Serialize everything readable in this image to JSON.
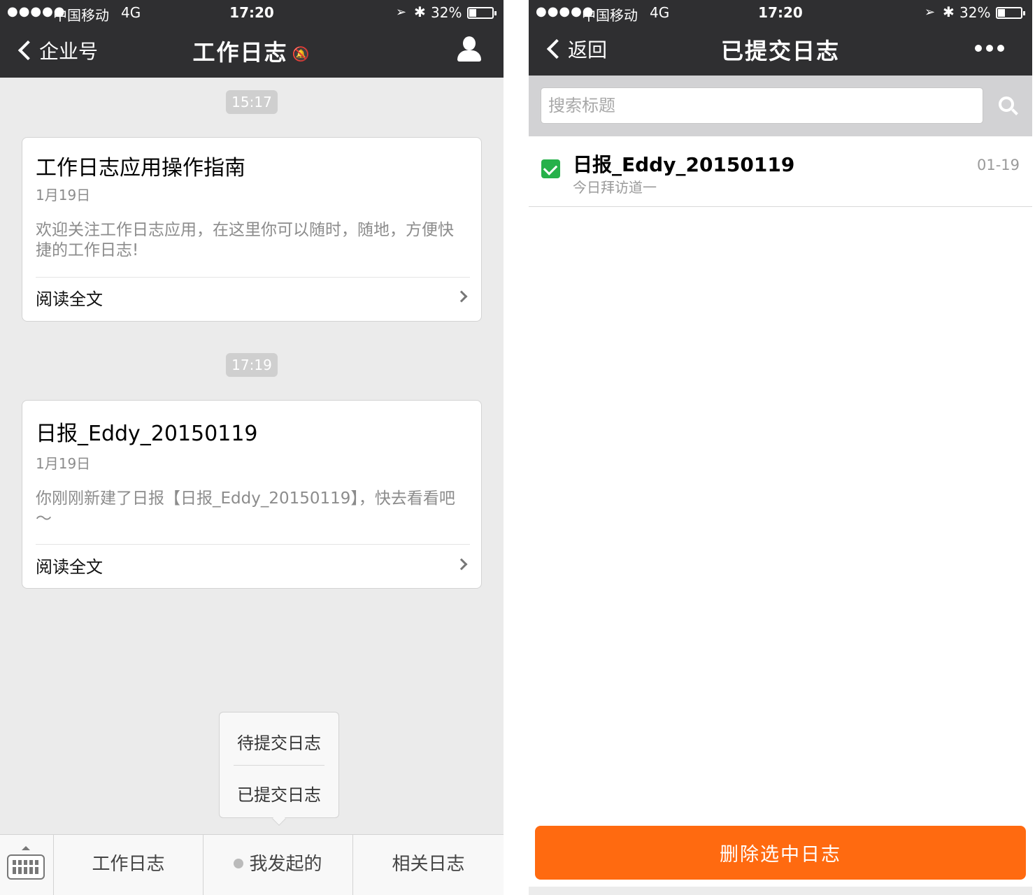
{
  "left": {
    "status": {
      "signal": "●●●●●",
      "carrier": "中国移动",
      "network": "4G",
      "time": "17:20",
      "battery_pct": "32%",
      "battery_level": 0.32
    },
    "nav": {
      "back_label": "企业号",
      "title": "工作日志"
    },
    "messages": [
      {
        "time": "15:17",
        "title": "工作日志应用操作指南",
        "date": "1月19日",
        "body": "欢迎关注工作日志应用，在这里你可以随时，随地，方便快捷的工作日志!",
        "link": "阅读全文"
      },
      {
        "time": "17:19",
        "title": "日报_Eddy_20150119",
        "date": "1月19日",
        "body": "你刚刚新建了日报【日报_Eddy_20150119】，快去看看吧～",
        "link": "阅读全文"
      }
    ],
    "popup": {
      "items": [
        "待提交日志",
        "已提交日志"
      ]
    },
    "menu": {
      "items": [
        "工作日志",
        "我发起的",
        "相关日志"
      ]
    }
  },
  "right": {
    "status": {
      "signal": "●●●●●",
      "carrier": "中国移动",
      "network": "4G",
      "time": "17:20",
      "battery_pct": "32%",
      "battery_level": 0.32
    },
    "nav": {
      "back_label": "返回",
      "title": "已提交日志"
    },
    "search": {
      "placeholder": "搜索标题",
      "value": ""
    },
    "logs": [
      {
        "title": "日报_Eddy_20150119",
        "subtitle": "今日拜访道一",
        "date": "01-19",
        "checked": true
      }
    ],
    "delete_label": "删除选中日志",
    "colors": {
      "header": "#2f2f31",
      "accent": "#ff6a10",
      "check": "#26b14a"
    }
  }
}
